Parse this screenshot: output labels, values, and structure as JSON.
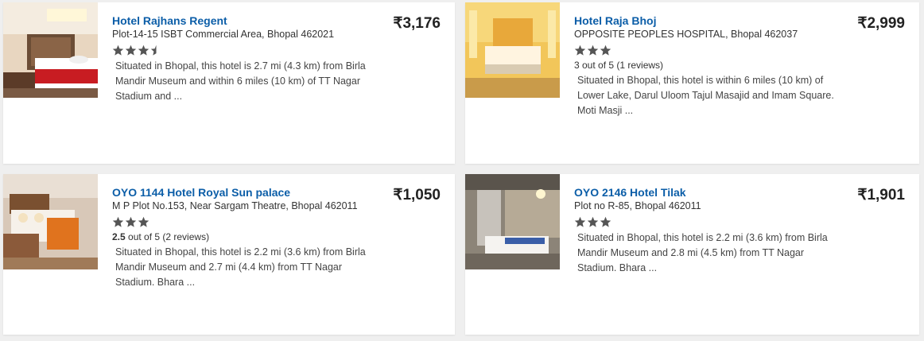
{
  "hotels": [
    {
      "name": "Hotel Rajhans Regent",
      "address": "Plot-14-15 ISBT Commercial Area, Bhopal 462021",
      "stars": 3.5,
      "rating_value": "",
      "rating_text": "",
      "description": "Situated in Bhopal, this hotel is 2.7 mi (4.3 km) from Birla Mandir Museum and within 6 miles (10 km) of TT Nagar Stadium and ...",
      "price": "₹3,176"
    },
    {
      "name": "Hotel Raja Bhoj",
      "address": "OPPOSITE PEOPLES HOSPITAL, Bhopal 462037",
      "stars": 3,
      "rating_value": "",
      "rating_text": "3 out of 5 (1 reviews)",
      "description": "Situated in Bhopal, this hotel is within 6 miles (10 km) of Lower Lake, Darul Uloom Tajul Masajid and Imam Square. Moti Masji ...",
      "price": "₹2,999"
    },
    {
      "name": "OYO 1144 Hotel Royal Sun palace",
      "address": "M P Plot No.153, Near Sargam Theatre, Bhopal 462011",
      "stars": 3,
      "rating_value": "2.5",
      "rating_text": " out of 5 (2 reviews)",
      "description": "Situated in Bhopal, this hotel is 2.2 mi (3.6 km) from Birla Mandir Museum and 2.7 mi (4.4 km) from TT Nagar Stadium. Bhara ...",
      "price": "₹1,050"
    },
    {
      "name": "OYO 2146 Hotel Tilak",
      "address": "Plot no R-85, Bhopal 462011",
      "stars": 3,
      "rating_value": "",
      "rating_text": "",
      "description": "Situated in Bhopal, this hotel is 2.2 mi (3.6 km) from Birla Mandir Museum and 2.8 mi (4.5 km) from TT Nagar Stadium. Bhara ...",
      "price": "₹1,901"
    }
  ],
  "colors": {
    "link": "#0c5ea8",
    "star": "#555555",
    "background": "#efefef"
  }
}
